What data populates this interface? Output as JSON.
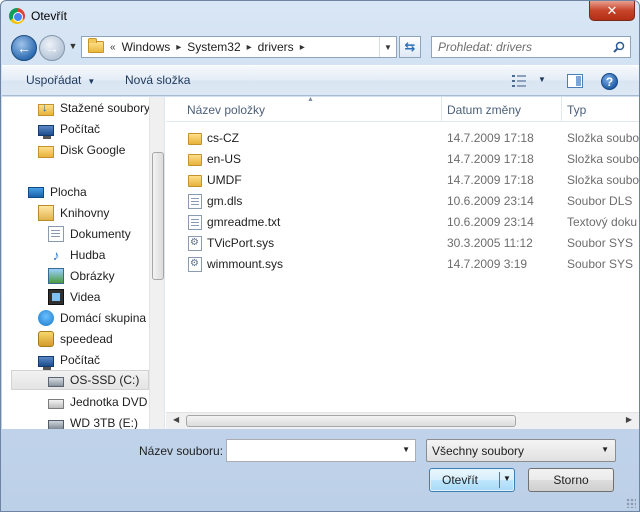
{
  "window": {
    "title": "Otevřít",
    "close_label": "✕"
  },
  "nav": {
    "back_icon": "back-arrow-icon",
    "forward_icon": "forward-arrow-icon"
  },
  "address": {
    "prefix": "«",
    "crumbs": [
      "Windows",
      "System32",
      "drivers"
    ],
    "separator": "▸"
  },
  "search": {
    "placeholder": "Prohledat: drivers"
  },
  "toolbar": {
    "organize_label": "Uspořádat",
    "new_folder_label": "Nová složka"
  },
  "sidebar": {
    "items": [
      {
        "label": "Stažené soubory",
        "icon": "downloads-folder-icon"
      },
      {
        "label": "Počítač",
        "icon": "computer-icon"
      },
      {
        "label": "Disk Google",
        "icon": "google-drive-folder-icon"
      },
      {
        "label": "Plocha",
        "icon": "desktop-icon"
      },
      {
        "label": "Knihovny",
        "icon": "libraries-icon"
      },
      {
        "label": "Dokumenty",
        "icon": "documents-icon"
      },
      {
        "label": "Hudba",
        "icon": "music-icon"
      },
      {
        "label": "Obrázky",
        "icon": "pictures-icon"
      },
      {
        "label": "Videa",
        "icon": "videos-icon"
      },
      {
        "label": "Domácí skupina",
        "icon": "homegroup-icon"
      },
      {
        "label": "speedead",
        "icon": "user-folder-icon"
      },
      {
        "label": "Počítač",
        "icon": "computer-icon"
      },
      {
        "label": "OS-SSD (C:)",
        "icon": "system-drive-icon"
      },
      {
        "label": "Jednotka DVD RW (D:)",
        "icon": "dvd-drive-icon"
      },
      {
        "label": "WD 3TB (E:)",
        "icon": "external-drive-icon"
      }
    ]
  },
  "columns": {
    "name": "Název položky",
    "date": "Datum změny",
    "type": "Typ"
  },
  "files": [
    {
      "name": "cs-CZ",
      "date": "14.7.2009 17:18",
      "type": "Složka soubor",
      "icon": "folder-icon"
    },
    {
      "name": "en-US",
      "date": "14.7.2009 17:18",
      "type": "Složka soubor",
      "icon": "folder-icon"
    },
    {
      "name": "UMDF",
      "date": "14.7.2009 17:18",
      "type": "Složka soubor",
      "icon": "folder-icon"
    },
    {
      "name": "gm.dls",
      "date": "10.6.2009 23:14",
      "type": "Soubor DLS",
      "icon": "file-icon"
    },
    {
      "name": "gmreadme.txt",
      "date": "10.6.2009 23:14",
      "type": "Textový doku",
      "icon": "text-file-icon"
    },
    {
      "name": "TVicPort.sys",
      "date": "30.3.2005 11:12",
      "type": "Soubor SYS",
      "icon": "system-file-icon"
    },
    {
      "name": "wimmount.sys",
      "date": "14.7.2009 3:19",
      "type": "Soubor SYS",
      "icon": "system-file-icon"
    }
  ],
  "bottom": {
    "filename_label": "Název souboru:",
    "filename_value": "",
    "filetype_value": "Všechny soubory",
    "open_label": "Otevřít",
    "cancel_label": "Storno"
  },
  "colors": {
    "accent": "#3c7fb1",
    "close_button": "#c7432a"
  }
}
